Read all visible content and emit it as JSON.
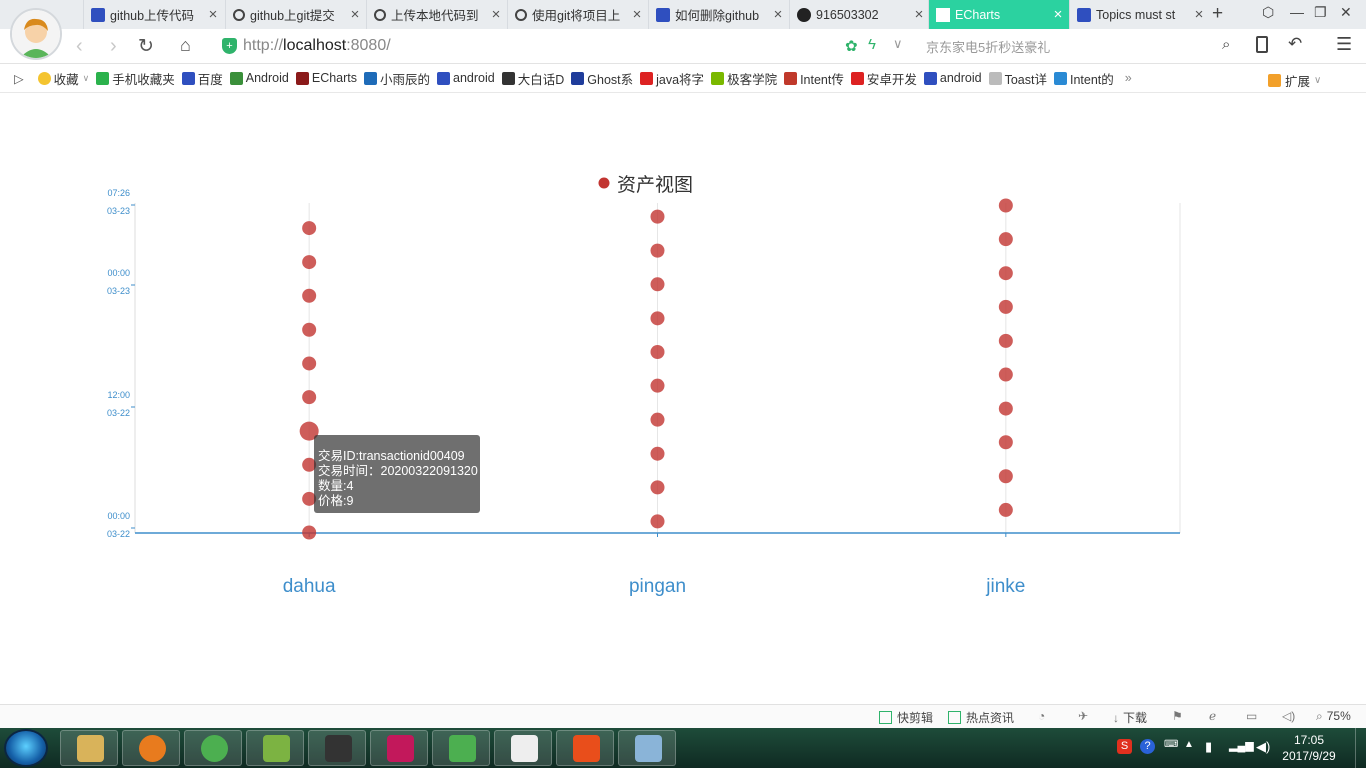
{
  "browser": {
    "tabs": [
      {
        "label": "github上传代码",
        "icon": "paw-icon"
      },
      {
        "label": "github上git提交",
        "icon": "git-icon"
      },
      {
        "label": "上传本地代码到",
        "icon": "git-icon"
      },
      {
        "label": "使用git将项目上",
        "icon": "git-icon"
      },
      {
        "label": "如何删除github",
        "icon": "paw-icon"
      },
      {
        "label": "916503302",
        "icon": "github-icon"
      },
      {
        "label": "ECharts",
        "icon": "doc-icon",
        "active": true
      },
      {
        "label": "Topics must st",
        "icon": "paw-icon"
      }
    ],
    "url_prefix": "http://",
    "url_host": "localhost",
    "url_suffix": ":8080/",
    "search_hint": "京东家电5折秒送豪礼",
    "bookmarks": [
      "收藏",
      "手机收藏夹",
      "百度",
      "Android",
      "ECharts",
      "小雨辰的",
      "android",
      "大白话D",
      "Ghost系",
      "java将字",
      "极客学院",
      "Intent传",
      "安卓开发",
      "android",
      "Toast详",
      "Intent的"
    ],
    "bookmark_more": "»",
    "extensions_label": "扩展"
  },
  "chart_data": {
    "type": "scatter",
    "legend": [
      "资产视图"
    ],
    "legend_position": "top-center",
    "series_color": "#c23531",
    "categories": [
      "dahua",
      "pingan",
      "jinke"
    ],
    "y_axis": {
      "type": "time",
      "ticks": [
        {
          "time": "00:00",
          "date": "03-22"
        },
        {
          "time": "12:00",
          "date": "03-22"
        },
        {
          "time": "00:00",
          "date": "03-23"
        },
        {
          "time": "07:26",
          "date": "03-23"
        }
      ]
    },
    "points": {
      "dahua": [
        0.0,
        0.103,
        0.207,
        0.31,
        0.414,
        0.517,
        0.62,
        0.724,
        0.827,
        0.931
      ],
      "pingan": [
        0.034,
        0.138,
        0.241,
        0.345,
        0.449,
        0.552,
        0.655,
        0.759,
        0.862,
        0.966
      ],
      "jinke": [
        0.069,
        0.172,
        0.276,
        0.379,
        0.483,
        0.586,
        0.69,
        0.793,
        0.897,
        1.0
      ]
    },
    "highlight": {
      "category": "dahua",
      "value": 0.31
    },
    "tooltip": {
      "line1": "交易ID:transactionid00409",
      "line2": "交易时间：20200322091320",
      "line3": "数量:4",
      "line4": "价格:9"
    }
  },
  "statusbar": {
    "clip_label": "快剪辑",
    "news_label": "热点资讯",
    "download_label": "下载",
    "zoom": "75%"
  },
  "taskbar": {
    "time": "17:05",
    "date": "2017/9/29",
    "apps": [
      "explorer",
      "firefox",
      "360-browser",
      "notepad",
      "mysql",
      "intellij",
      "wechat",
      "app-7",
      "git-gui",
      "app-9"
    ]
  }
}
